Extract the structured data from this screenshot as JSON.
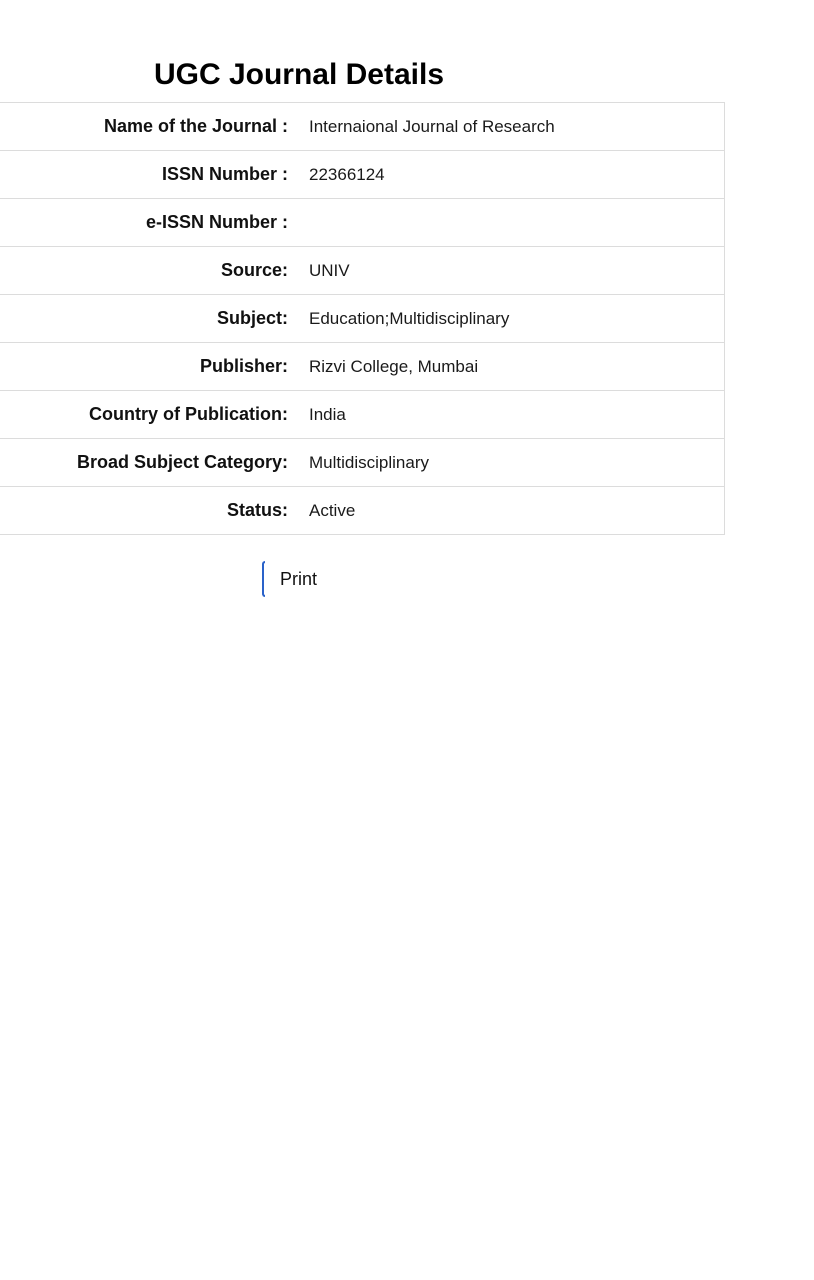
{
  "page": {
    "title": "UGC Journal Details"
  },
  "details": [
    {
      "label": "Name of the Journal :",
      "value": "Internaional Journal of Research"
    },
    {
      "label": "ISSN Number :",
      "value": "22366124"
    },
    {
      "label": "e-ISSN Number :",
      "value": ""
    },
    {
      "label": "Source:",
      "value": "UNIV"
    },
    {
      "label": "Subject:",
      "value": "Education;Multidisciplinary"
    },
    {
      "label": "Publisher:",
      "value": "Rizvi College, Mumbai"
    },
    {
      "label": "Country of Publication:",
      "value": "India"
    },
    {
      "label": "Broad Subject Category:",
      "value": "Multidisciplinary"
    },
    {
      "label": "Status:",
      "value": "Active"
    }
  ],
  "actions": {
    "print_label": "Print"
  },
  "colors": {
    "accent": "#2a62c9",
    "border": "#dcdcdc"
  }
}
